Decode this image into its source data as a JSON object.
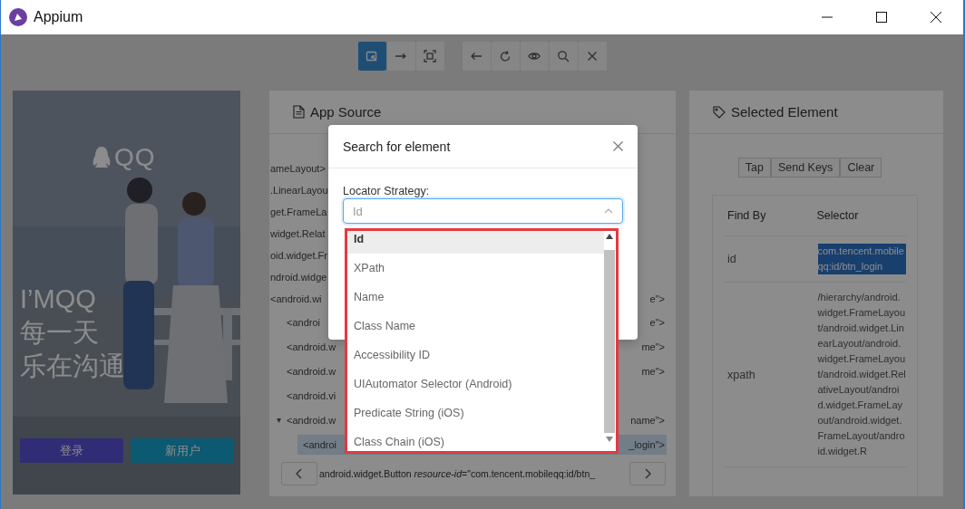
{
  "window": {
    "title": "Appium"
  },
  "toolbar": {
    "groups": [
      [
        {
          "kind": "select",
          "selected": true
        },
        {
          "kind": "swipe",
          "selected": false
        },
        {
          "kind": "tap",
          "selected": false
        }
      ],
      [
        {
          "kind": "back",
          "selected": false
        },
        {
          "kind": "refresh",
          "selected": false
        },
        {
          "kind": "eye",
          "selected": false
        },
        {
          "kind": "search",
          "selected": false
        },
        {
          "kind": "close",
          "selected": false
        }
      ]
    ]
  },
  "device_screen": {
    "logo": "QQ",
    "headline": [
      "I’MQQ",
      "每一天",
      "乐在沟通"
    ],
    "buttons": [
      {
        "label": "登录"
      },
      {
        "label": "新用户"
      }
    ]
  },
  "app_source": {
    "title": "App Source",
    "tree": [
      {
        "left": "ameLayout>",
        "selected": false
      },
      {
        "left": ".LinearLayou",
        "selected": false
      },
      {
        "left": "get.FrameLa",
        "selected": false
      },
      {
        "left": "widget.Relat",
        "selected": false
      },
      {
        "left": "oid.widget.Fr",
        "selected": false
      },
      {
        "left": "ndroid.widge",
        "selected": false
      },
      {
        "left": "<android.wi",
        "right": "e\">",
        "selected": false,
        "children": [
          {
            "left": "<androi",
            "right": "e\">",
            "selected": false
          },
          {
            "left": "<android.w",
            "right": "me\">",
            "selected": false
          },
          {
            "left": "<android.w",
            "right": "me\">",
            "selected": false
          },
          {
            "left": "<android.vi",
            "selected": false
          },
          {
            "left": "<android.w",
            "right": "name\">",
            "toggle": "▾",
            "selected": false,
            "children": [
              {
                "left": "<androi",
                "right": "_login\">",
                "selected": true
              }
            ]
          }
        ]
      }
    ],
    "path": "android.widget.Button *resource-id*=\"com.tencent.mobileqq:id/btn_"
  },
  "selected_element": {
    "title": "Selected Element",
    "actions": [
      "Tap",
      "Send Keys",
      "Clear"
    ],
    "columns": [
      "Find By",
      "Selector"
    ],
    "rows": [
      {
        "find_by": "id",
        "selector": "com.tencent.mobileqq:id/btn_login",
        "selected": true
      },
      {
        "find_by": "xpath",
        "selector": "/hierarchy/android.widget.FrameLayout/android.widget.LinearLayout/android.widget.FrameLayout/android.widget.RelativeLayout/android.widget.FrameLayout/android.widget.FrameLayout/android.widget.R",
        "selected": false
      }
    ]
  },
  "dialog": {
    "title": "Search for element",
    "field_label": "Locator Strategy:",
    "select": {
      "value": "Id",
      "expanded": true
    },
    "options": [
      {
        "label": "Id",
        "selected": true
      },
      {
        "label": "XPath",
        "selected": false
      },
      {
        "label": "Name",
        "selected": false
      },
      {
        "label": "Class Name",
        "selected": false
      },
      {
        "label": "Accessibility ID",
        "selected": false
      },
      {
        "label": "UIAutomator Selector (Android)",
        "selected": false
      },
      {
        "label": "Predicate String (iOS)",
        "selected": false
      },
      {
        "label": "Class Chain (iOS)",
        "selected": false
      }
    ]
  }
}
